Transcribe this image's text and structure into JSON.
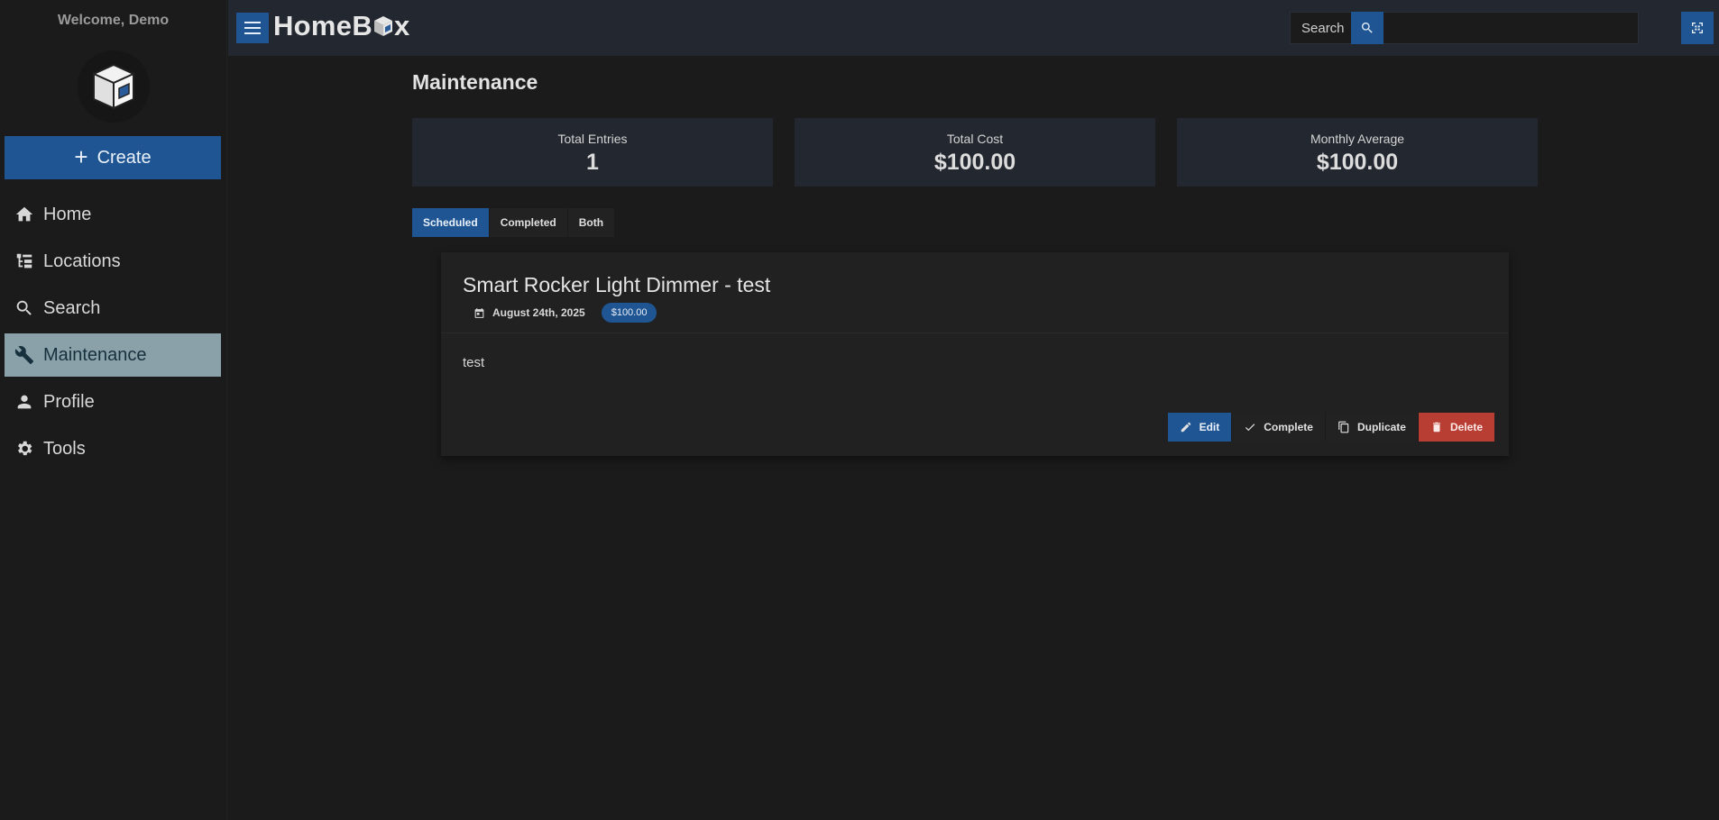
{
  "sidebar": {
    "welcome": "Welcome, Demo",
    "create_label": "Create",
    "items": [
      {
        "label": "Home",
        "icon": "home-icon"
      },
      {
        "label": "Locations",
        "icon": "tree-icon"
      },
      {
        "label": "Search",
        "icon": "search-icon"
      },
      {
        "label": "Maintenance",
        "icon": "wrench-icon",
        "active": true
      },
      {
        "label": "Profile",
        "icon": "person-icon"
      },
      {
        "label": "Tools",
        "icon": "gear-icon"
      }
    ]
  },
  "header": {
    "brand_left": "HomeB",
    "brand_right": "x",
    "search_placeholder": "Search"
  },
  "page": {
    "title": "Maintenance",
    "stats": [
      {
        "label": "Total Entries",
        "value": "1"
      },
      {
        "label": "Total Cost",
        "value": "$100.00"
      },
      {
        "label": "Monthly Average",
        "value": "$100.00"
      }
    ],
    "tabs": [
      "Scheduled",
      "Completed",
      "Both"
    ],
    "active_tab": "Scheduled"
  },
  "entry": {
    "title": "Smart Rocker Light Dimmer - test",
    "date": "August 24th, 2025",
    "cost": "$100.00",
    "notes": "test",
    "actions": {
      "edit": "Edit",
      "complete": "Complete",
      "duplicate": "Duplicate",
      "delete": "Delete"
    }
  },
  "colors": {
    "accent": "#1f5592",
    "active_nav": "#8aa1a9",
    "danger": "#b83d33",
    "surface": "#232830",
    "background": "#1b1b1b"
  }
}
